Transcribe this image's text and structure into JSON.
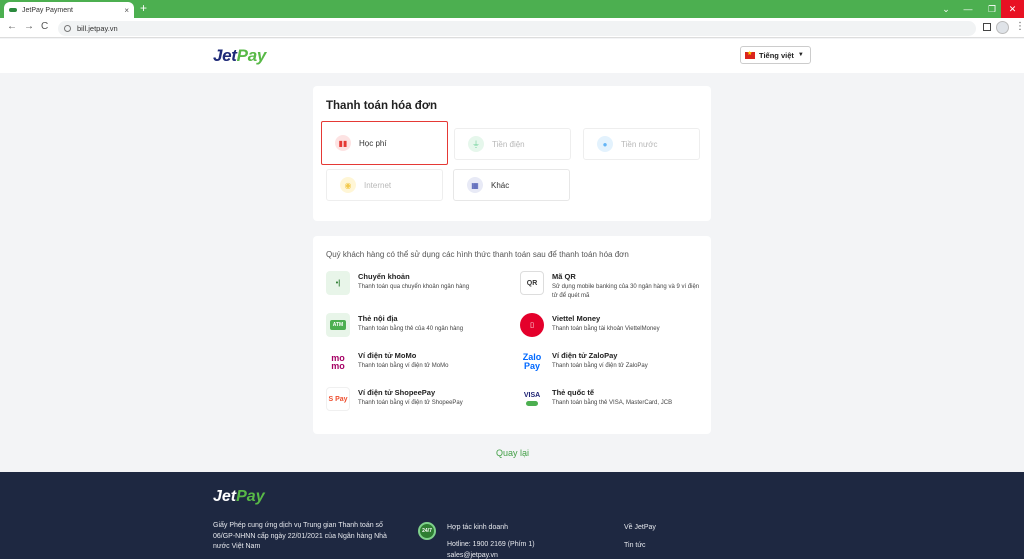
{
  "browser": {
    "tab_title": "JetPay Payment",
    "url": "bill.jetpay.vn",
    "new_tab": "+",
    "close_tab": "×"
  },
  "header": {
    "logo_part1": "Jet",
    "logo_part2": "Pay",
    "language": "Tiếng việt"
  },
  "bill_section": {
    "title": "Thanh toán hóa đơn",
    "services": [
      {
        "label": "Học phí",
        "icon": "tuition-icon",
        "state": "selected"
      },
      {
        "label": "Tiền điện",
        "icon": "electricity-icon",
        "state": "disabled"
      },
      {
        "label": "Tiền nước",
        "icon": "water-icon",
        "state": "disabled"
      },
      {
        "label": "Internet",
        "icon": "internet-icon",
        "state": "disabled"
      },
      {
        "label": "Khác",
        "icon": "grid-icon",
        "state": "enabled"
      }
    ]
  },
  "payment_methods": {
    "intro": "Quý khách hàng có thể sử dụng các hình thức thanh toán sau để thanh toán hóa đơn",
    "items": [
      {
        "title": "Chuyển khoản",
        "desc": "Thanh toán qua chuyển khoản ngân hàng",
        "logo": "•|"
      },
      {
        "title": "Mã QR",
        "desc": "Sử dụng mobile banking của 30 ngân hàng và 9 ví điện tử để quét mã",
        "logo": "QR"
      },
      {
        "title": "Thẻ nội địa",
        "desc": "Thanh toán bằng thẻ của 40 ngân hàng",
        "logo": "ATM"
      },
      {
        "title": "Viettel Money",
        "desc": "Thanh toán bằng tài khoản ViettelMoney",
        "logo": "▯"
      },
      {
        "title": "Ví điện tử MoMo",
        "desc": "Thanh toán bằng ví điện tử MoMo",
        "logo": "mo mo"
      },
      {
        "title": "Ví điện tử ZaloPay",
        "desc": "Thanh toán bằng ví điện tử ZaloPay",
        "logo": "Zalo Pay"
      },
      {
        "title": "Ví điện tử ShopeePay",
        "desc": "Thanh toán bằng ví điện tử ShopeePay",
        "logo": "S Pay"
      },
      {
        "title": "Thẻ quốc tế",
        "desc": "Thanh toán bằng thẻ VISA, MasterCard, JCB",
        "logo": "VISA"
      }
    ]
  },
  "back_label": "Quay lại",
  "footer": {
    "logo_part1": "Jet",
    "logo_part2": "Pay",
    "license": "Giấy Phép cung ứng dịch vụ Trung gian Thanh toán số 06/GP-NHNN cấp ngày 22/01/2021 của Ngân hàng Nhà nước Việt Nam",
    "badge": "24/7",
    "business_title": "Hợp tác kinh doanh",
    "hotline": "Hotline: 1900 2169 (Phím 1)",
    "email": "sales@jetpay.vn",
    "links": [
      "Về JetPay",
      "Tin tức"
    ]
  }
}
